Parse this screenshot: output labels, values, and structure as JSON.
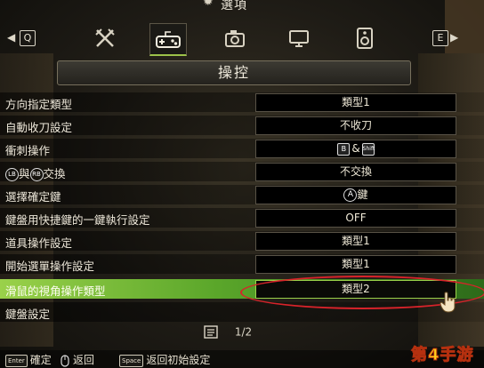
{
  "header": {
    "title": "選項",
    "icon": "gear-icon"
  },
  "tabbar": {
    "left_key": "Q",
    "right_key": "E",
    "tabs": [
      {
        "name": "combat",
        "icon": "crossed-swords-icon",
        "active": false
      },
      {
        "name": "controls",
        "icon": "gamepad-icon",
        "active": true
      },
      {
        "name": "camera",
        "icon": "camera-icon",
        "active": false
      },
      {
        "name": "display",
        "icon": "monitor-icon",
        "active": false
      },
      {
        "name": "sound",
        "icon": "speaker-icon",
        "active": false
      }
    ]
  },
  "section": {
    "title": "操控"
  },
  "rows": [
    {
      "label": "方向指定類型",
      "value": "類型1"
    },
    {
      "label": "自動收刀設定",
      "value": "不收刀"
    },
    {
      "label": "衝刺操作",
      "value_parts": [
        "B",
        "&",
        "Shift"
      ]
    },
    {
      "label_parts": [
        "LB",
        "與",
        "RB",
        "交換"
      ],
      "value": "不交換"
    },
    {
      "label": "選擇確定鍵",
      "value_parts": [
        "A",
        "鍵"
      ]
    },
    {
      "label": "鍵盤用快捷鍵的一鍵執行設定",
      "value": "OFF"
    },
    {
      "label": "道具操作設定",
      "value": "類型1"
    },
    {
      "label": "開始選單操作設定",
      "value": "類型1"
    },
    {
      "label": "滑鼠的視角操作類型",
      "value": "類型2",
      "highlighted": true
    },
    {
      "label": "鍵盤設定"
    }
  ],
  "pager": {
    "text": "1/2"
  },
  "footer": {
    "confirm": {
      "key": "Enter",
      "label": "確定"
    },
    "back": {
      "key": "mouse",
      "label": "返回"
    },
    "reset": {
      "key": "Space",
      "label": "返回初始設定"
    }
  },
  "watermark": {
    "text": "第4手游"
  },
  "colors": {
    "highlight": "#9ad14a",
    "annotation": "#d8232a",
    "active_tab_underline": "#9cc24a"
  }
}
